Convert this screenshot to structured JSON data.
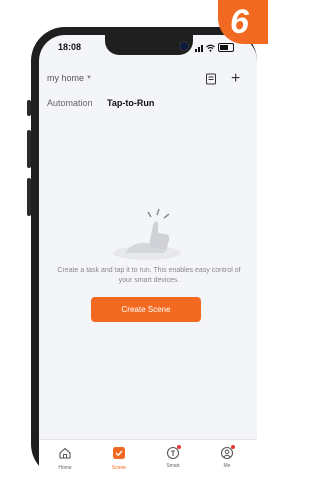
{
  "badge": {
    "number": "6",
    "color": "#f26a21"
  },
  "status_bar": {
    "time": "18:08"
  },
  "header": {
    "home_selector": "my home"
  },
  "tabs": [
    {
      "label": "Automation",
      "selected": false
    },
    {
      "label": "Tap-to-Run",
      "selected": true
    }
  ],
  "empty_state": {
    "message": "Create a task and tap it to run. This enables easy control of your smart devices.",
    "button_label": "Create Scene"
  },
  "tab_bar": [
    {
      "label": "Home",
      "icon": "home-icon",
      "selected": false
    },
    {
      "label": "Scene",
      "icon": "scene-icon",
      "selected": true
    },
    {
      "label": "Smart",
      "icon": "smart-icon",
      "selected": false
    },
    {
      "label": "Me",
      "icon": "me-icon",
      "selected": false
    }
  ],
  "colors": {
    "accent": "#f26a21",
    "background": "#f4f5f8"
  }
}
